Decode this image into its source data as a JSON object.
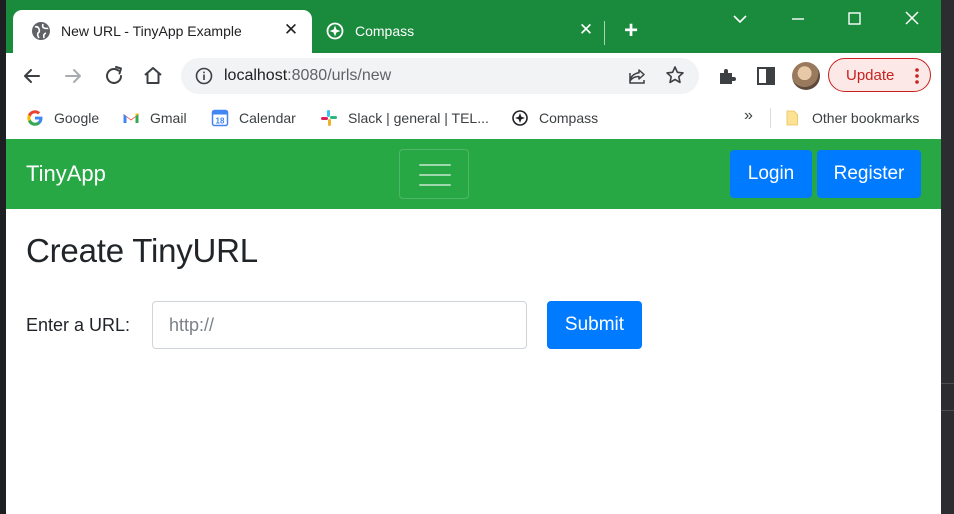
{
  "browser": {
    "tabs": [
      {
        "title": "New URL - TinyApp Example",
        "active": true,
        "close": "✕"
      },
      {
        "title": "Compass",
        "active": false,
        "close": "✕"
      }
    ],
    "new_tab": "+",
    "url_host": "localhost",
    "url_path": ":8080/urls/new",
    "update_label": "Update",
    "bookmarks": [
      {
        "label": "Google",
        "icon": "google-icon"
      },
      {
        "label": "Gmail",
        "icon": "gmail-icon"
      },
      {
        "label": "Calendar",
        "icon": "calendar-icon"
      },
      {
        "label": "Slack | general | TEL...",
        "icon": "slack-icon"
      },
      {
        "label": "Compass",
        "icon": "compass-icon"
      }
    ],
    "more_bookmarks": "»",
    "other_bookmarks": "Other bookmarks",
    "calendar_day": "18"
  },
  "app": {
    "brand": "TinyApp",
    "login": "Login",
    "register": "Register",
    "heading": "Create TinyURL",
    "url_label": "Enter a URL:",
    "url_placeholder": "http://",
    "url_value": "",
    "submit": "Submit"
  },
  "colors": {
    "frame": "#1a8a3c",
    "navbar": "#28a745",
    "primary": "#007bff",
    "update": "#c5221f"
  }
}
